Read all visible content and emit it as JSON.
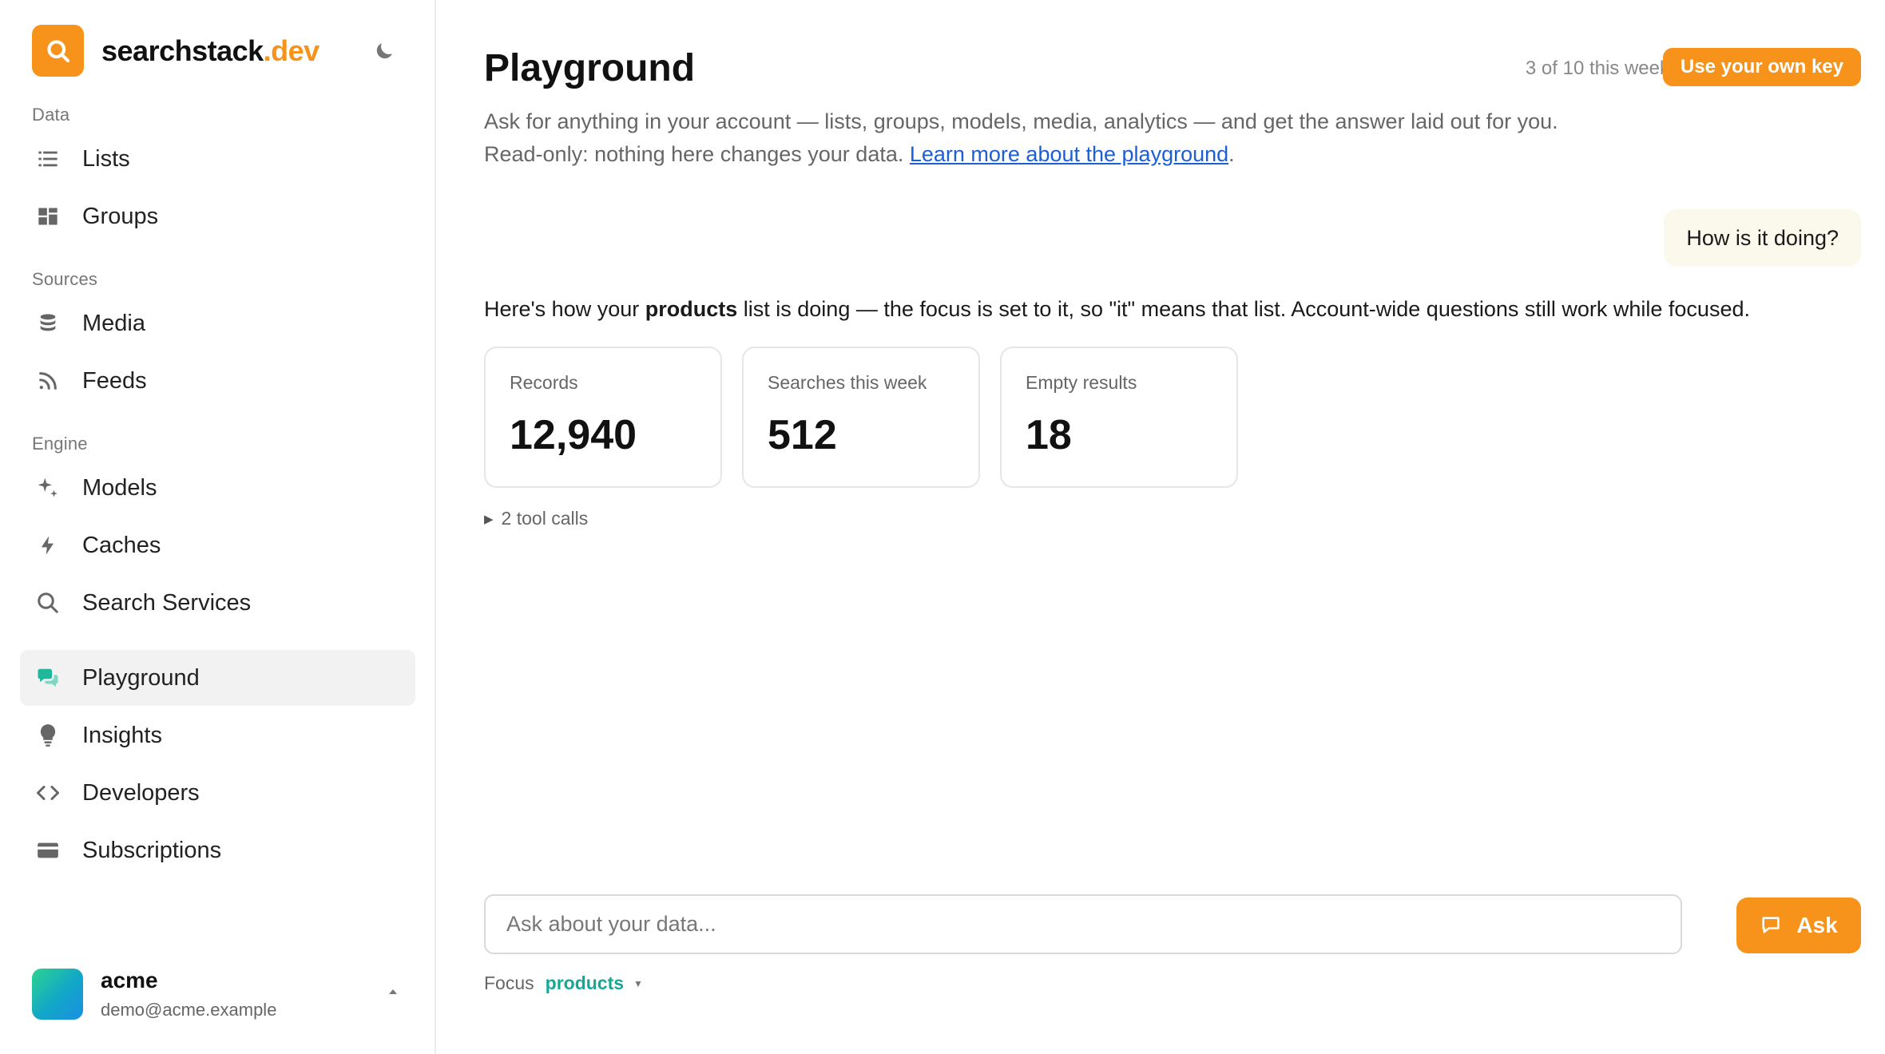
{
  "brand": {
    "name": "searchstack",
    "tld": ".dev"
  },
  "sidebar": {
    "sections": [
      {
        "label": "Data"
      },
      {
        "label": "Sources"
      },
      {
        "label": "Engine"
      }
    ],
    "items": [
      {
        "label": "Lists",
        "icon": "list-icon"
      },
      {
        "label": "Groups",
        "icon": "grid-icon"
      },
      {
        "label": "Media",
        "icon": "database-icon"
      },
      {
        "label": "Feeds",
        "icon": "rss-icon"
      },
      {
        "label": "Models",
        "icon": "sparkle-icon"
      },
      {
        "label": "Caches",
        "icon": "bolt-icon"
      },
      {
        "label": "Search Services",
        "icon": "search-icon"
      },
      {
        "label": "Playground",
        "icon": "chat-icon",
        "active": true
      },
      {
        "label": "Insights",
        "icon": "lightbulb-icon"
      },
      {
        "label": "Developers",
        "icon": "code-icon"
      },
      {
        "label": "Subscriptions",
        "icon": "card-icon"
      }
    ],
    "account": {
      "name": "acme",
      "email": "demo@acme.example"
    }
  },
  "header": {
    "title": "Playground",
    "usage": "3 of 10 this week",
    "own_key_label": "Use your own key",
    "description_line1": "Ask for anything in your account — lists, groups, models, media, analytics — and get the answer laid out for you.",
    "description_line2_prefix": "Read-only: nothing here changes your data. ",
    "description_link": "Learn more about the playground",
    "description_line2_suffix": "."
  },
  "conversation": {
    "user_message": "How is it doing?",
    "answer_prefix": "Here's how your ",
    "answer_bold": "products",
    "answer_suffix": " list is doing — the focus is set to it, so \"it\" means that list. Account-wide questions still work while focused.",
    "stats": [
      {
        "label": "Records",
        "value": "12,940"
      },
      {
        "label": "Searches this week",
        "value": "512"
      },
      {
        "label": "Empty results",
        "value": "18"
      }
    ],
    "tool_calls_label": "2 tool calls"
  },
  "composer": {
    "placeholder": "Ask about your data...",
    "value": "",
    "ask_label": "Ask",
    "focus_label": "Focus",
    "focus_value": "products"
  },
  "colors": {
    "accent": "#f7931a",
    "focus_teal": "#16a896",
    "link": "#1a5fd6",
    "user_bubble": "#fbf8ec",
    "active_nav": "#f2f2f2"
  }
}
